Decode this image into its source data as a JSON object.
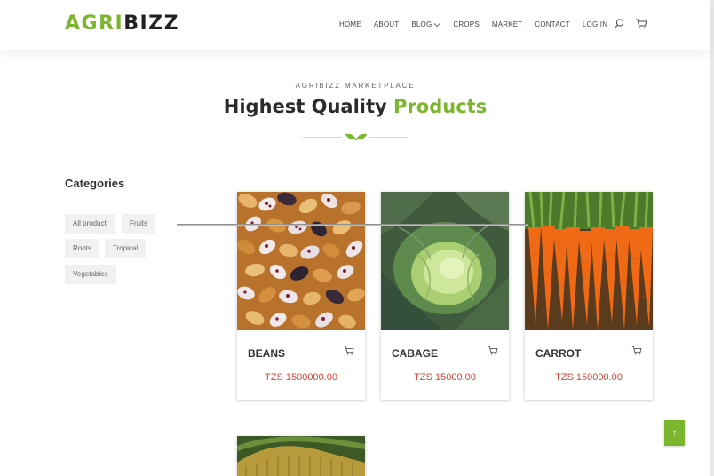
{
  "logo": {
    "part1": "AGRI",
    "part2": "BIZZ"
  },
  "nav": {
    "items": [
      "HOME",
      "ABOUT",
      "BLOG",
      "CROPS",
      "MARKET",
      "CONTACT",
      "LOG IN"
    ],
    "icons": [
      "search-icon",
      "cart-icon"
    ]
  },
  "section": {
    "eyebrow": "AGRIBIZZ MARKETPLACE",
    "title_main": "Highest Quality",
    "title_accent": "Products"
  },
  "sidebar": {
    "title": "Categories",
    "tags": [
      "All product",
      "Fruits",
      "Roots",
      "Tropical",
      "Vegetables"
    ]
  },
  "products": [
    {
      "name": "BEANS",
      "price": "TZS 1500000.00"
    },
    {
      "name": "CABAGE",
      "price": "TZS 15000.00"
    },
    {
      "name": "CARROT",
      "price": "TZS 150000.00"
    }
  ],
  "scroll_top": {
    "label": "↑"
  },
  "colors": {
    "accent": "#7ab72e",
    "price": "#d6453b",
    "text": "#2b2b2b"
  }
}
